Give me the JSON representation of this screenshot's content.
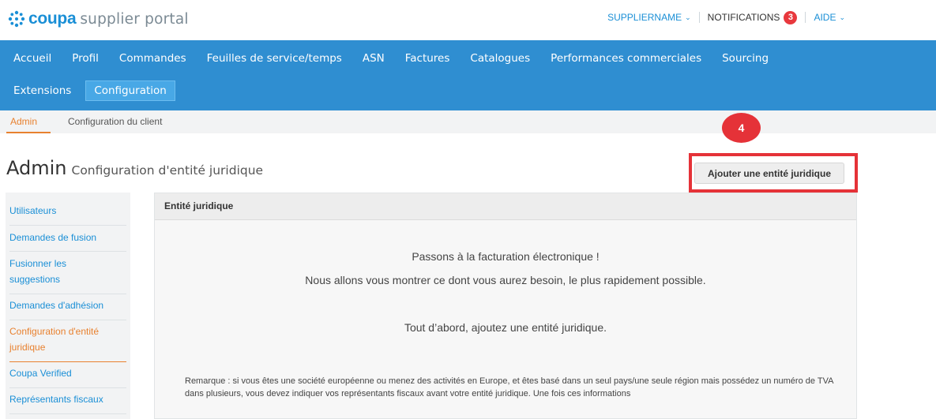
{
  "header": {
    "logo_brand": "coupa",
    "logo_rest": "supplier portal",
    "supplier_name": "SUPPLIERNAME",
    "notifications_label": "NOTIFICATIONS",
    "notifications_count": "3",
    "help_label": "AIDE",
    "colors": {
      "brand": "#1a8fd6",
      "badge": "#e8383d"
    }
  },
  "nav": {
    "row1": [
      "Accueil",
      "Profil",
      "Commandes",
      "Feuilles de service/temps",
      "ASN",
      "Factures",
      "Catalogues",
      "Performances commerciales",
      "Sourcing"
    ],
    "row2": [
      "Extensions",
      "Configuration"
    ],
    "active": "Configuration",
    "color": "#2f8ed1"
  },
  "subnav": {
    "admin": "Admin",
    "client": "Configuration du client"
  },
  "step_badge": "4",
  "page": {
    "title": "Admin",
    "subtitle": "Configuration d'entité juridique",
    "add_button": "Ajouter une entité juridique"
  },
  "sidebar": {
    "items": [
      "Utilisateurs",
      "Demandes de fusion",
      "Fusionner les",
      "suggestions",
      "Demandes d'adhésion",
      "Configuration d'entité",
      "juridique",
      "Coupa Verified",
      "Représentants fiscaux"
    ]
  },
  "panel": {
    "header": "Entité juridique",
    "line1": "Passons à la facturation électronique  !",
    "line2": "Nous allons vous montrer ce dont vous aurez besoin, le plus rapidement possible.",
    "line3": "Tout d’abord, ajoutez une entité juridique.",
    "note": "Remarque : si vous êtes une société européenne ou menez des activités en Europe, et êtes basé dans un seul pays/une seule région mais possédez un numéro de TVA dans plusieurs, vous devez indiquer vos représentants fiscaux avant votre entité juridique. Une fois ces informations"
  }
}
